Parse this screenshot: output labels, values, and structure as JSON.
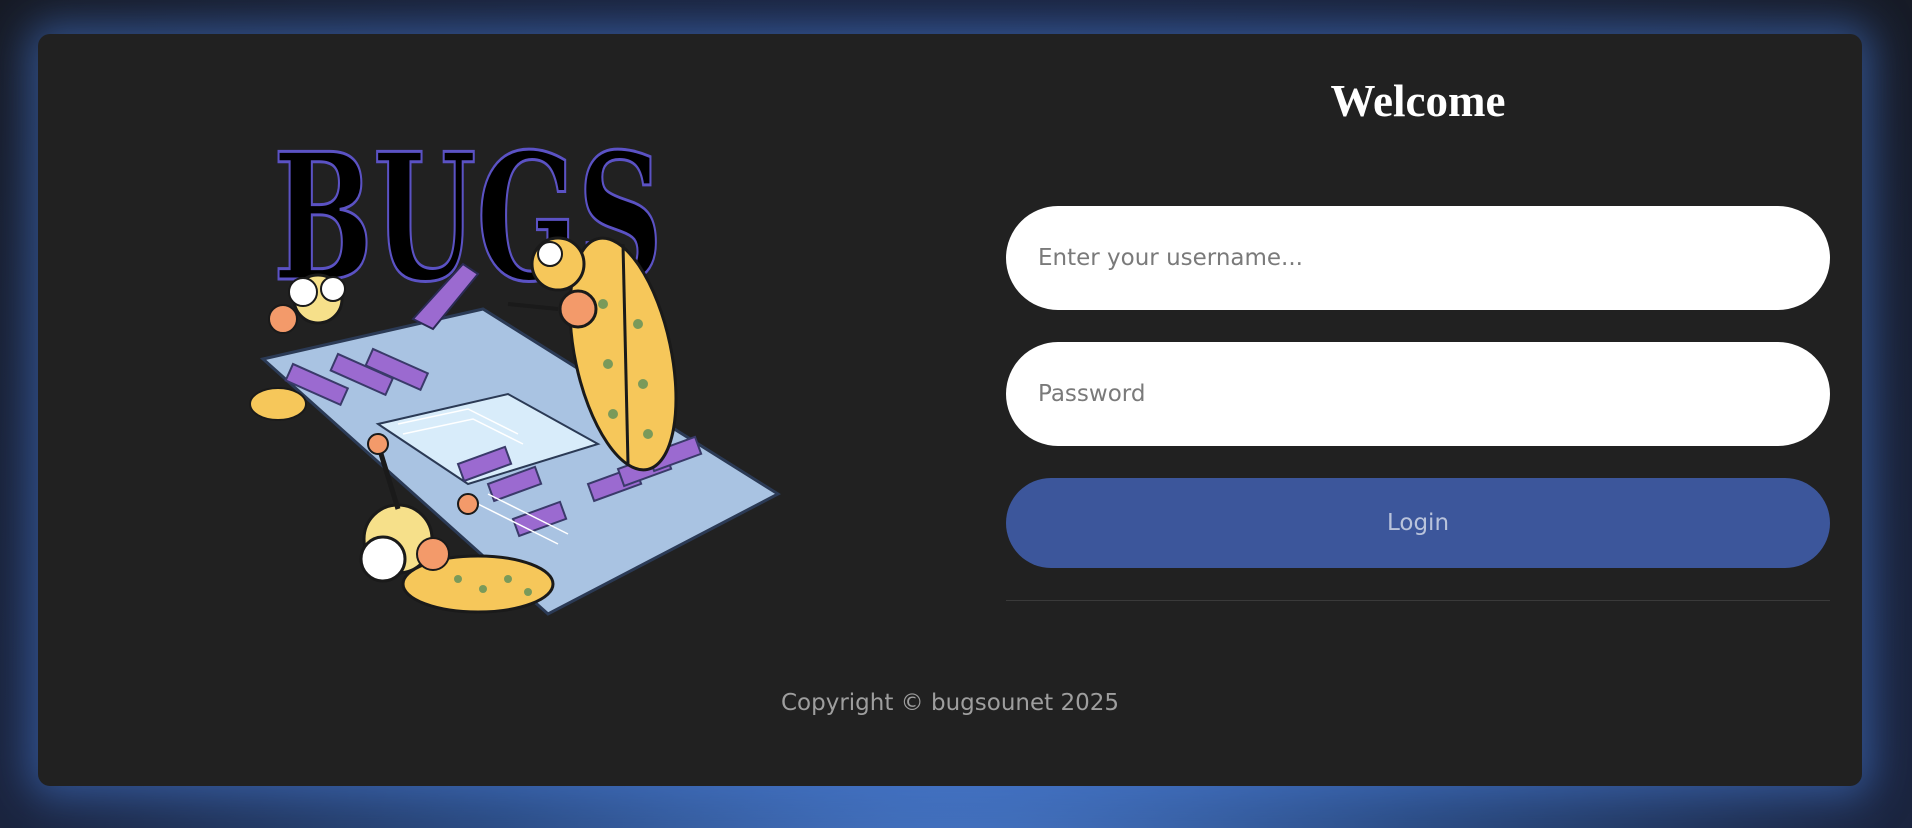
{
  "logo": {
    "text": "BUGS",
    "icon": "bugs-logo"
  },
  "login": {
    "title": "Welcome",
    "username_placeholder": "Enter your username...",
    "password_placeholder": "Password",
    "login_label": "Login"
  },
  "footer": {
    "copyright": "Copyright © bugsounet 2025"
  },
  "colors": {
    "card_bg": "#212121",
    "button": "#3c569b",
    "glow": "#4a7cd0",
    "logo_purple": "#5b52c4",
    "bug_yellow": "#f6c75a"
  }
}
